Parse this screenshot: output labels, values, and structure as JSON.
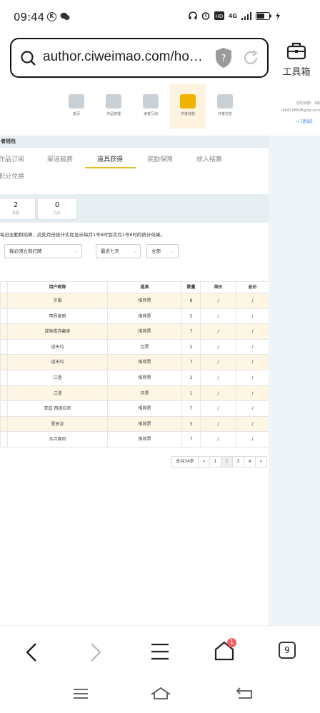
{
  "status_bar": {
    "time": "09:44",
    "k_icon": "K",
    "network": "4G"
  },
  "browser": {
    "url": "author.ciweimao.com/ho…",
    "toolbox_label": "工具箱",
    "tab_count": "9",
    "notification_count": "1"
  },
  "site_nav": {
    "items": [
      {
        "label": "首页",
        "icon": "paw-icon"
      },
      {
        "label": "作品管理",
        "icon": "book-icon"
      },
      {
        "label": "读者互动",
        "icon": "paw-icon"
      },
      {
        "label": "作者钱包",
        "icon": "wallet-icon"
      },
      {
        "label": "作者信息",
        "icon": "id-card-icon"
      }
    ],
    "account_line1": "您的余额：2级",
    "account_line2": "1468198608@qq.com",
    "logout_label": "[退出]"
  },
  "wallet": {
    "section_title": "者钱包",
    "tabs": [
      "作品订阅",
      "渠道稿费",
      "道具获得",
      "奖励保障",
      "收入结算",
      "积分兑换"
    ],
    "active_tab": "道具获得",
    "stats": [
      {
        "value": "2",
        "label": "月票"
      },
      {
        "value": "0",
        "label": "刀片"
      }
    ],
    "note": "每日全勤和结算，此处月份统计实际显示每月1号6时到次月1号6时的统计结果。",
    "filters": {
      "book": "我必须立刻打牌",
      "range": "最近七天",
      "type": "全部"
    }
  },
  "table": {
    "headers": [
      "用户昵称",
      "道具",
      "数量",
      "单价",
      "总价"
    ],
    "rows": [
      [
        "尔雅",
        "推荐票",
        "8",
        "/",
        "/"
      ],
      [
        "冥界黄鸦",
        "推荐票",
        "5",
        "/",
        "/"
      ],
      [
        "成鱼拔弃翻身",
        "推荐票",
        "7",
        "/",
        "/"
      ],
      [
        "道天均",
        "月票",
        "2",
        "/",
        "/"
      ],
      [
        "道天均",
        "推荐票",
        "7",
        "/",
        "/"
      ],
      [
        "江澄",
        "推荐票",
        "2",
        "/",
        "/"
      ],
      [
        "江澄",
        "月票",
        "1",
        "/",
        "/"
      ],
      [
        "亚茲·西德拉奇",
        "推荐票",
        "7",
        "/",
        "/"
      ],
      [
        "星辰龙",
        "推荐票",
        "5",
        "/",
        "/"
      ],
      [
        "水月靡风",
        "推荐票",
        "7",
        "/",
        "/"
      ]
    ]
  },
  "pagination": {
    "total": "总共34条",
    "pages": [
      "«",
      "1",
      "2",
      "3",
      "4",
      "»"
    ],
    "current": "2"
  }
}
